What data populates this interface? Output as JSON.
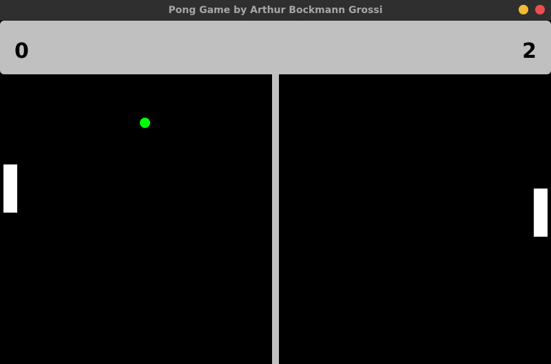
{
  "window": {
    "title": "Pong Game by Arthur Bockmann Grossi"
  },
  "scoreboard": {
    "left_score": "0",
    "right_score": "2"
  },
  "colors": {
    "titlebar": "#2f2f2f",
    "title_text": "#a6a6a6",
    "minimize": "#f6b932",
    "close": "#ee4d4d",
    "scoreboard": "#c0c0c0",
    "field": "#000000",
    "net": "#c0c0c0",
    "paddle": "#ffffff",
    "ball": "#00ff00"
  }
}
